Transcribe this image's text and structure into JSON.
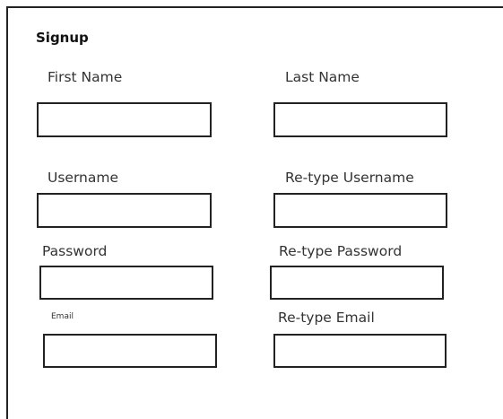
{
  "form": {
    "title": "Signup",
    "fields": {
      "first_name": {
        "label": "First Name",
        "value": "",
        "placeholder": ""
      },
      "last_name": {
        "label": "Last Name",
        "value": "",
        "placeholder": ""
      },
      "username": {
        "label": "Username",
        "value": "",
        "placeholder": ""
      },
      "retype_username": {
        "label": "Re-type Username",
        "value": "",
        "placeholder": ""
      },
      "password": {
        "label": "Password",
        "value": "",
        "placeholder": ""
      },
      "retype_password": {
        "label": "Re-type Password",
        "value": "",
        "placeholder": ""
      },
      "email": {
        "label": "Email",
        "value": "",
        "placeholder": ""
      },
      "retype_email": {
        "label": "Re-type Email",
        "value": "",
        "placeholder": ""
      }
    }
  }
}
